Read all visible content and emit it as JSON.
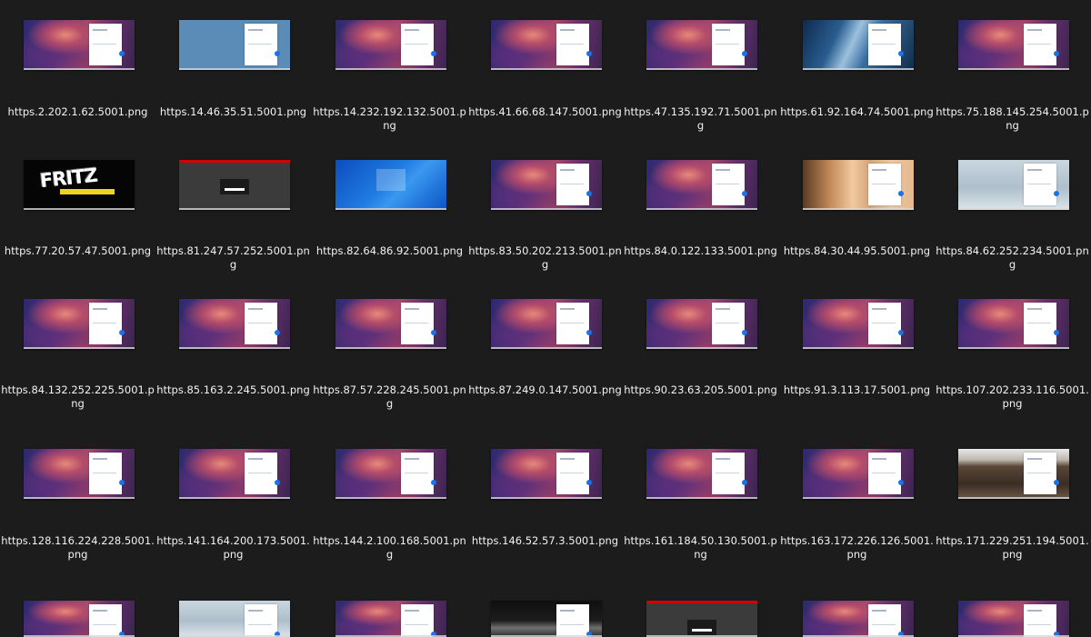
{
  "rows": [
    {
      "tiles": [
        {
          "style": "canyon",
          "filename": "https.2.202.1.62.5001.png"
        },
        {
          "style": "blue",
          "filename": "https.14.46.35.51.5001.png"
        },
        {
          "style": "canyon",
          "filename": "https.14.232.192.132.5001.png"
        },
        {
          "style": "canyon",
          "filename": "https.41.66.68.147.5001.png"
        },
        {
          "style": "canyon",
          "filename": "https.47.135.192.71.5001.png"
        },
        {
          "style": "building",
          "filename": "https.61.92.164.74.5001.png"
        },
        {
          "style": "canyon",
          "filename": "https.75.188.145.254.5001.png"
        }
      ]
    },
    {
      "tiles": [
        {
          "style": "fritz",
          "filename": "https.77.20.57.47.5001.png"
        },
        {
          "style": "darkred",
          "filename": "https.81.247.57.252.5001.png"
        },
        {
          "style": "winblue",
          "filename": "https.82.64.86.92.5001.png"
        },
        {
          "style": "canyon",
          "filename": "https.83.50.202.213.5001.png"
        },
        {
          "style": "canyon",
          "filename": "https.84.0.122.133.5001.png"
        },
        {
          "style": "face",
          "filename": "https.84.30.44.95.5001.png"
        },
        {
          "style": "bridge",
          "filename": "https.84.62.252.234.5001.png"
        }
      ]
    },
    {
      "tiles": [
        {
          "style": "canyon",
          "filename": "https.84.132.252.225.5001.png"
        },
        {
          "style": "canyon",
          "filename": "https.85.163.2.245.5001.png"
        },
        {
          "style": "canyon",
          "filename": "https.87.57.228.245.5001.png"
        },
        {
          "style": "canyon",
          "filename": "https.87.249.0.147.5001.png"
        },
        {
          "style": "canyon",
          "filename": "https.90.23.63.205.5001.png"
        },
        {
          "style": "canyon",
          "filename": "https.91.3.113.17.5001.png"
        },
        {
          "style": "canyon",
          "filename": "https.107.202.233.116.5001.png"
        }
      ]
    },
    {
      "tiles": [
        {
          "style": "canyon",
          "filename": "https.128.116.224.228.5001.png"
        },
        {
          "style": "canyon",
          "filename": "https.141.164.200.173.5001.png"
        },
        {
          "style": "canyon",
          "filename": "https.144.2.100.168.5001.png"
        },
        {
          "style": "canyon",
          "filename": "https.146.52.57.3.5001.png"
        },
        {
          "style": "canyon",
          "filename": "https.161.184.50.130.5001.png"
        },
        {
          "style": "canyon",
          "filename": "https.163.172.226.126.5001.png"
        },
        {
          "style": "roof",
          "filename": "https.171.229.251.194.5001.png"
        }
      ]
    },
    {
      "tiles": [
        {
          "style": "canyon",
          "filename": ""
        },
        {
          "style": "bridge",
          "filename": ""
        },
        {
          "style": "canyon",
          "filename": ""
        },
        {
          "style": "night",
          "filename": ""
        },
        {
          "style": "darkred",
          "filename": ""
        },
        {
          "style": "canyon",
          "filename": ""
        },
        {
          "style": "canyon",
          "filename": ""
        }
      ]
    }
  ],
  "colors": {
    "background": "#1c1c1c",
    "caption_text": "#f2f2f2",
    "accent_blue": "#1a73e8"
  }
}
